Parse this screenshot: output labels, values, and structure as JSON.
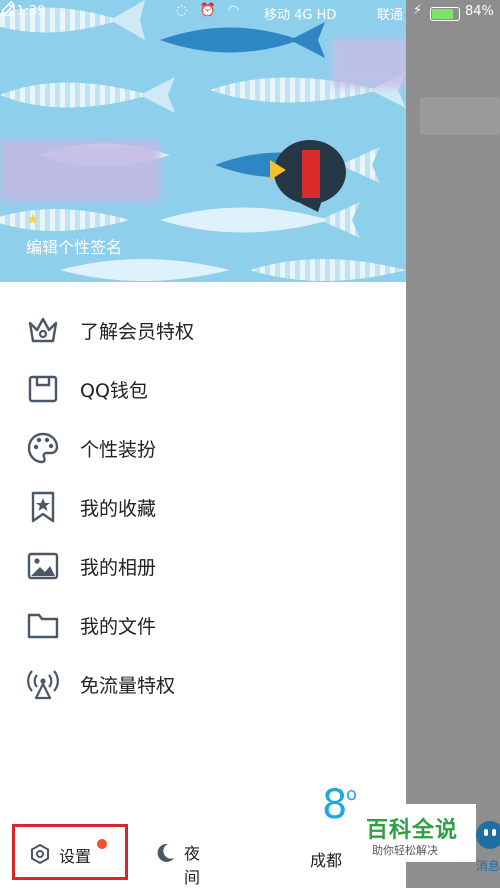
{
  "status_bar": {
    "time": "21:39",
    "network": "移动 4G HD",
    "carrier": "联通",
    "battery": "84%",
    "battery_level": 0.84
  },
  "profile": {
    "signature": "编辑个性签名"
  },
  "menu": {
    "items": [
      {
        "label": "了解会员特权",
        "icon": "crown-icon"
      },
      {
        "label": "QQ钱包",
        "icon": "wallet-icon"
      },
      {
        "label": "个性装扮",
        "icon": "palette-icon"
      },
      {
        "label": "我的收藏",
        "icon": "bookmark-star-icon"
      },
      {
        "label": "我的相册",
        "icon": "photo-icon"
      },
      {
        "label": "我的文件",
        "icon": "folder-icon"
      },
      {
        "label": "免流量特权",
        "icon": "antenna-icon"
      }
    ]
  },
  "bottom_bar": {
    "settings_label": "设置",
    "night_label": "夜间",
    "temperature": "8",
    "temperature_unit": "o",
    "city": "成都"
  },
  "side_tab": {
    "label": "消息"
  },
  "watermark": {
    "title": "百科全说",
    "subtitle": "助你轻松解决"
  },
  "colors": {
    "accent": "#1ea6e8",
    "highlight_box": "#d6272e",
    "badge": "#f0502e",
    "banner": "#8ecfec"
  }
}
